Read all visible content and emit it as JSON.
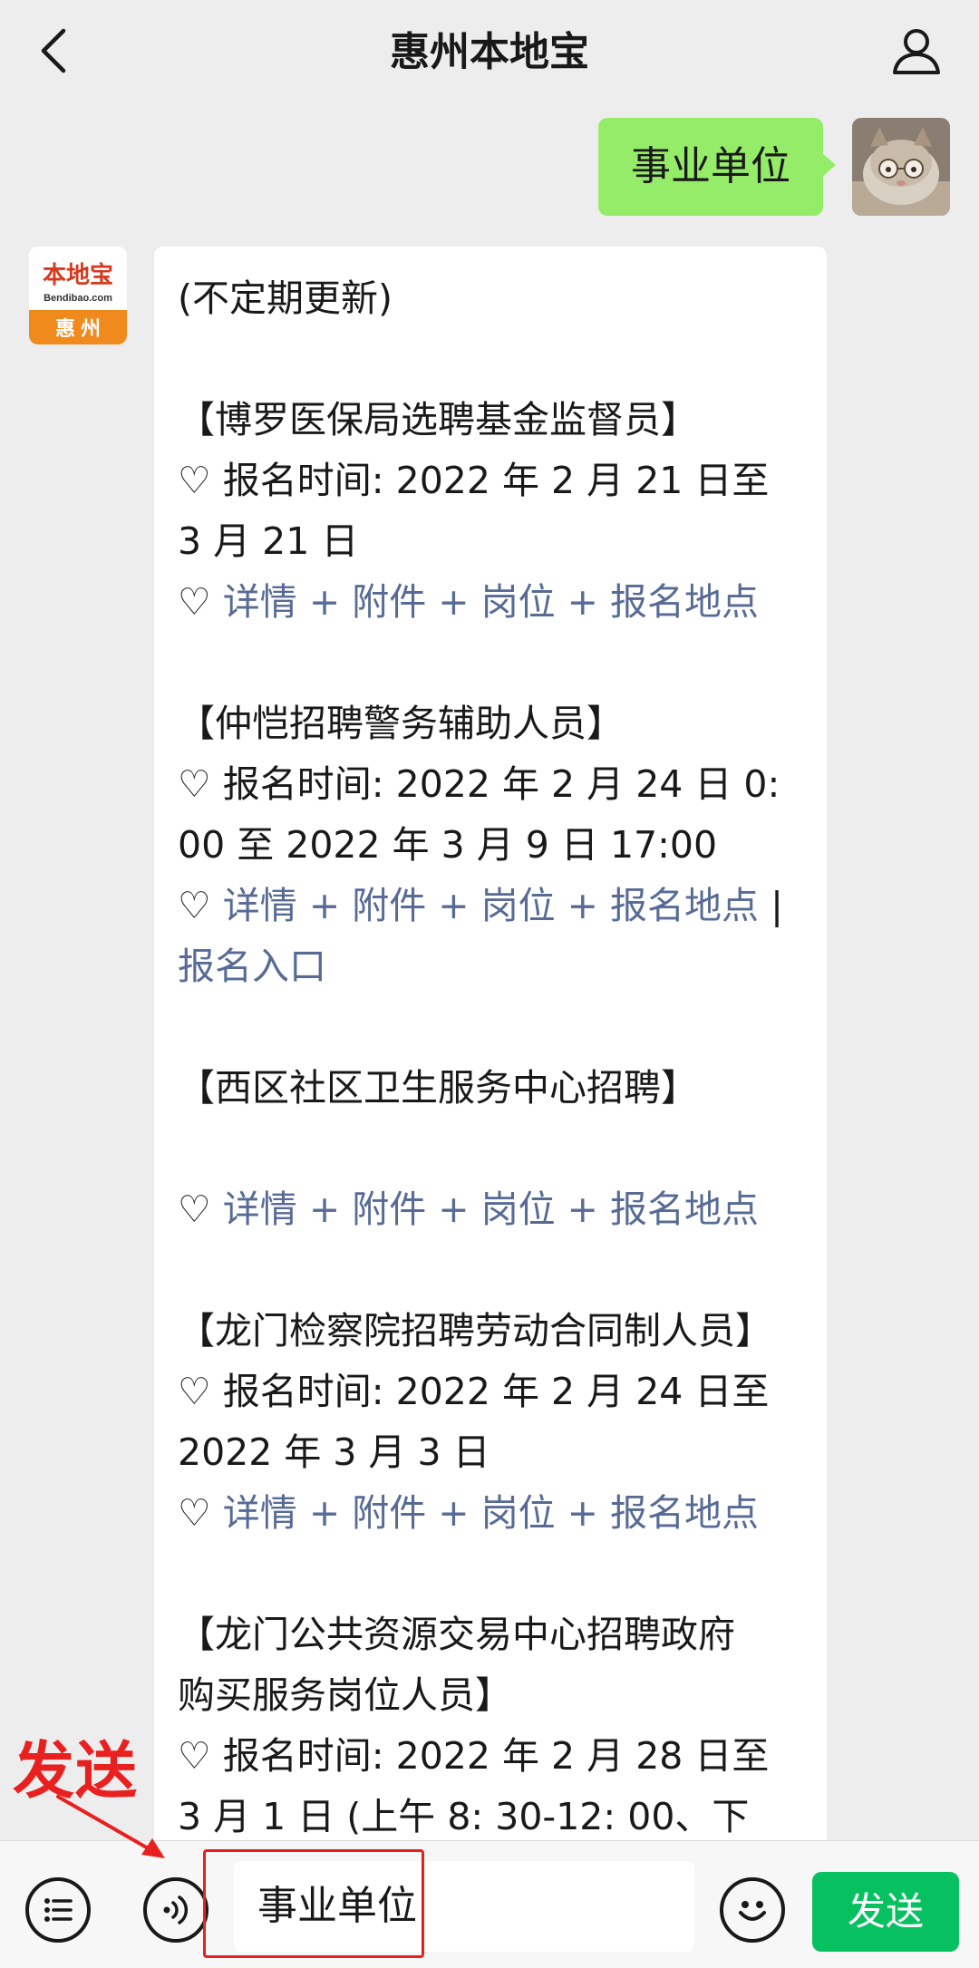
{
  "header": {
    "title": "惠州本地宝"
  },
  "outgoing": {
    "text": "事业单位"
  },
  "bot_avatar": {
    "logo_text": "本地宝",
    "logo_sub": "Bendibao.com",
    "city": "惠 州"
  },
  "message": {
    "intro": "(不定期更新)",
    "items": [
      {
        "title": "【博罗医保局选聘基金监督员】",
        "time_line1": "♡ 报名时间: 2022 年 2 月 21 日至",
        "time_line2": "3 月 21 日",
        "links_line1": "详情 + 附件 + 岗位 + 报名地点",
        "links_line2": ""
      },
      {
        "title": "【仲恺招聘警务辅助人员】",
        "time_line1": "♡ 报名时间: 2022 年 2 月 24 日 0:",
        "time_line2": "00 至 2022 年 3 月 9 日 17:00",
        "links_line1": "详情 + 附件 + 岗位 + 报名地点",
        "links_line2": "报名入口"
      },
      {
        "title": "【西区社区卫生服务中心招聘】",
        "links_line1": "详情 + 附件 + 岗位 + 报名地点"
      },
      {
        "title": "【龙门检察院招聘劳动合同制人员】",
        "time_line1": "♡ 报名时间: 2022 年 2 月 24 日至",
        "time_line2": "2022 年 3 月 3 日",
        "links_line1": "详情 + 附件 + 岗位 + 报名地点"
      },
      {
        "title_line1": "【龙门公共资源交易中心招聘政府",
        "title_line2": "购买服务岗位人员】",
        "time_line1": "♡ 报名时间: 2022 年 2 月 28 日至",
        "time_line2": "3 月 1 日 (上午 8: 30-12: 00、下"
      }
    ]
  },
  "inputbar": {
    "text": "事业单位",
    "send_label": "发送"
  },
  "annotation": {
    "label": "发送"
  },
  "icons": {
    "back": "chevron-left-icon",
    "profile": "person-icon",
    "menu": "list-icon",
    "voice": "voice-icon",
    "emoji": "smiley-icon",
    "heart": "heart-outline-icon"
  },
  "colors": {
    "background": "#ededed",
    "bubble_out": "#95ec69",
    "link": "#576b95",
    "send_button": "#07c160",
    "annotation": "#e8201f",
    "logo_orange": "#f08a1d"
  }
}
